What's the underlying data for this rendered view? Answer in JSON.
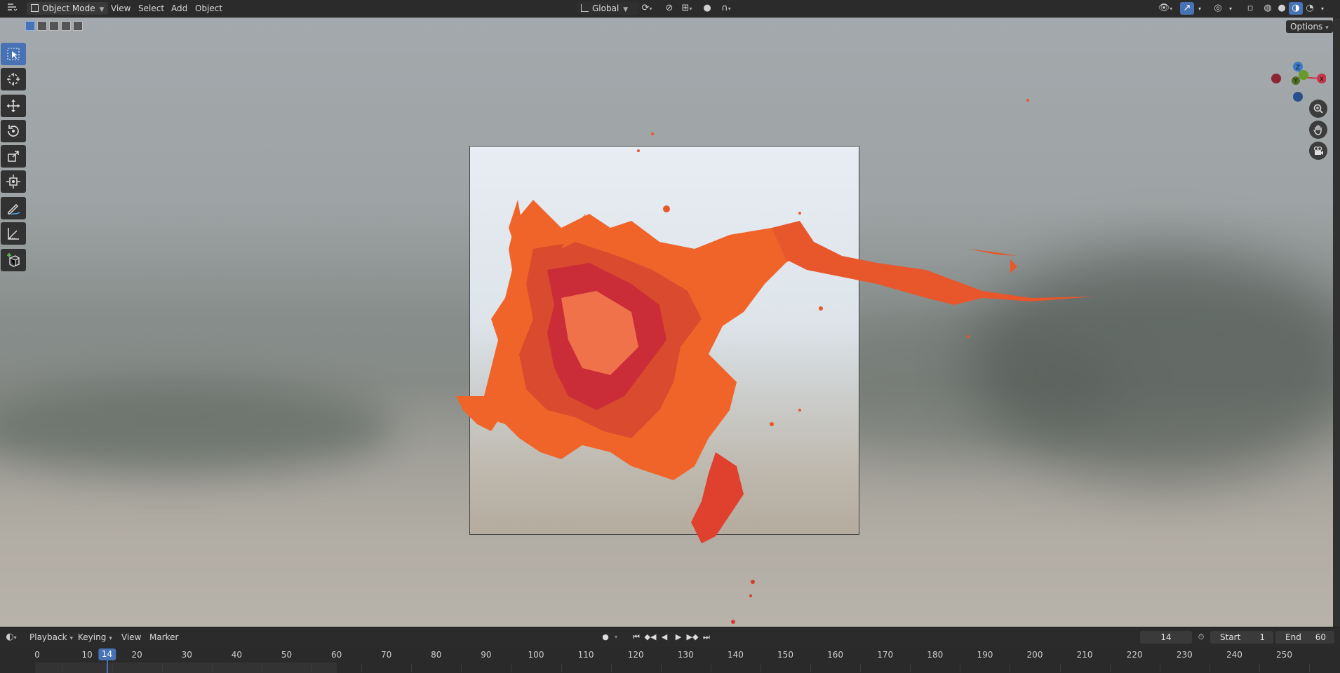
{
  "header": {
    "mode": "Object Mode",
    "menus": [
      "View",
      "Select",
      "Add",
      "Object"
    ],
    "orientation": "Global"
  },
  "viewport": {
    "options_label": "Options",
    "gizmo_axes": {
      "z": "Z",
      "y": "Y",
      "x": "X"
    }
  },
  "toolbar": {
    "tools": [
      "select-box",
      "cursor",
      "move",
      "rotate",
      "scale",
      "transform",
      "annotate",
      "measure",
      "add-cube"
    ]
  },
  "timeline": {
    "menus": [
      "Playback",
      "Keying",
      "View",
      "Marker"
    ],
    "current_frame": "14",
    "start_label": "Start",
    "start_value": "1",
    "end_label": "End",
    "end_value": "60",
    "ticks": [
      "0",
      "10",
      "20",
      "30",
      "40",
      "50",
      "60",
      "70",
      "80",
      "90",
      "100",
      "110",
      "120",
      "130",
      "140",
      "150",
      "160",
      "170",
      "180",
      "190",
      "200",
      "210",
      "220",
      "230",
      "240",
      "250"
    ]
  },
  "colors": {
    "accent": "#4772b3",
    "axis_x": "#c8374a",
    "axis_y": "#6a9a2a",
    "axis_z": "#3c78c8",
    "splash_orange": "#f0642a",
    "splash_red": "#c8283a"
  }
}
